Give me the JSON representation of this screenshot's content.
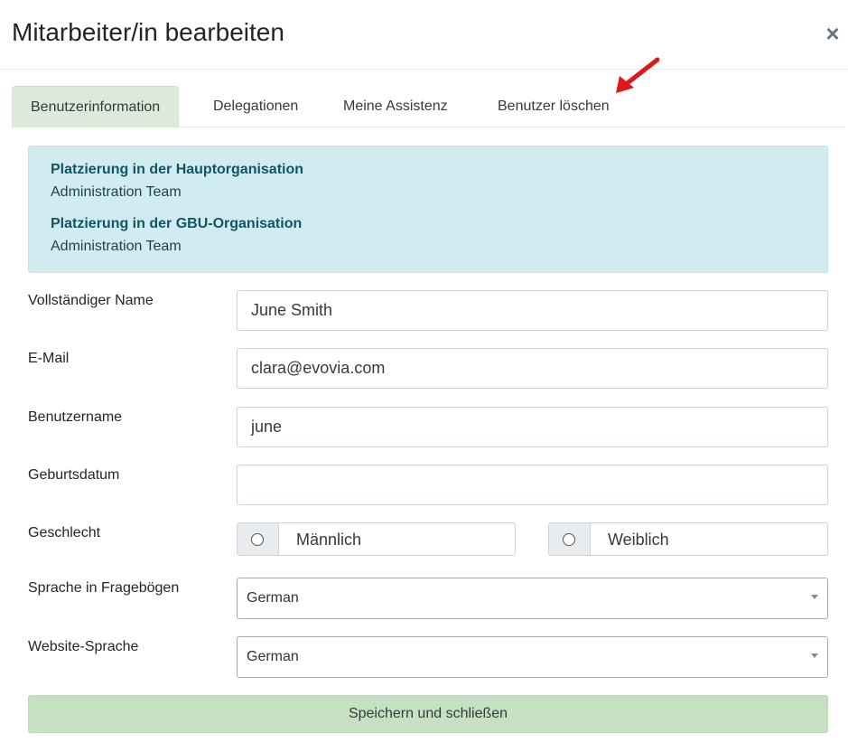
{
  "modal": {
    "title": "Mitarbeiter/in bearbeiten",
    "close_label": "×"
  },
  "tabs": [
    {
      "label": "Benutzerinformation",
      "active": true
    },
    {
      "label": "Delegationen",
      "active": false
    },
    {
      "label": "Meine Assistenz",
      "active": false
    },
    {
      "label": "Benutzer löschen",
      "active": false
    }
  ],
  "info": {
    "main_org_heading": "Platzierung in der Hauptorganisation",
    "main_org_value": "Administration Team",
    "gbu_org_heading": "Platzierung in der GBU-Organisation",
    "gbu_org_value": "Administration Team"
  },
  "form": {
    "full_name_label": "Vollständiger Name",
    "full_name_value": "June Smith",
    "email_label": "E-Mail",
    "email_value": "clara@evovia.com",
    "username_label": "Benutzername",
    "username_value": "june",
    "birthdate_label": "Geburtsdatum",
    "birthdate_value": "",
    "gender_label": "Geschlecht",
    "gender_options": [
      "Männlich",
      "Weiblich"
    ],
    "questionnaire_lang_label": "Sprache in Fragebögen",
    "questionnaire_lang_value": "German",
    "website_lang_label": "Website-Sprache",
    "website_lang_value": "German"
  },
  "actions": {
    "save_label": "Speichern und schließen"
  },
  "colors": {
    "active_tab": "#dcebd9",
    "info_bg": "#d1ecf1",
    "save_button": "#c6e1c2",
    "annotation_arrow": "#e0161b"
  }
}
